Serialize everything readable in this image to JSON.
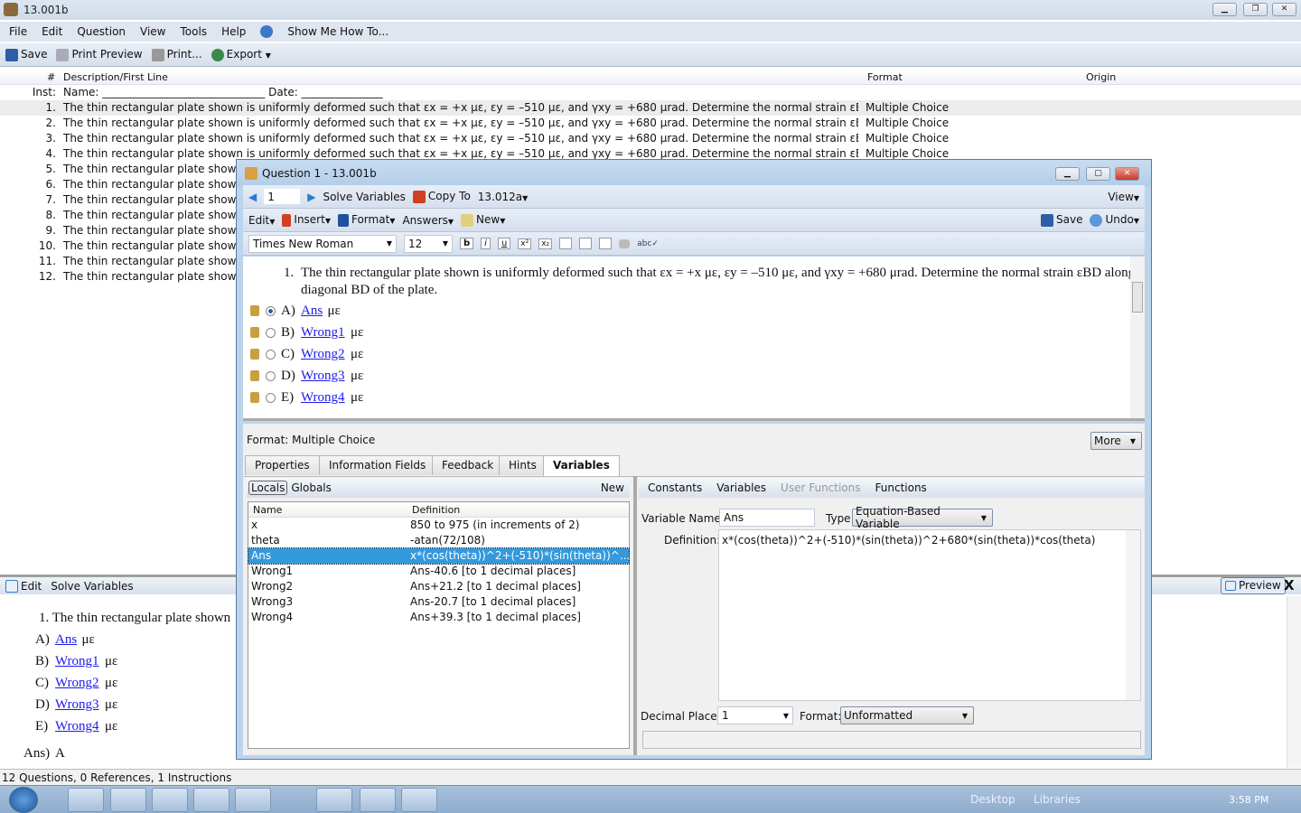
{
  "window": {
    "title": "13.001b"
  },
  "menu": [
    "File",
    "Edit",
    "Question",
    "View",
    "Tools",
    "Help",
    "Show Me How To..."
  ],
  "toolbar": {
    "save": "Save",
    "print_preview": "Print Preview",
    "print": "Print...",
    "export": "Export"
  },
  "list": {
    "headers": {
      "num": "#",
      "desc": "Description/First Line",
      "format": "Format",
      "origin": "Origin"
    },
    "inst": {
      "label": "Inst:",
      "text": "Name: ______________________________   Date: _______________"
    },
    "rows": [
      {
        "num": "1.",
        "desc": "The thin rectangular plate shown is uniformly deformed such that εx = +x με, εy = –510 με, and γxy = +680 μrad.  Determine the normal strain εBD along dia...",
        "format": "Multiple Choice"
      },
      {
        "num": "2.",
        "desc": "The thin rectangular plate shown is uniformly deformed such that εx = +x με, εy = –510 με, and γxy = +680 μrad.  Determine the normal strain εBD along dia...",
        "format": "Multiple Choice"
      },
      {
        "num": "3.",
        "desc": "The thin rectangular plate shown is uniformly deformed such that εx = +x με, εy = –510 με, and γxy = +680 μrad.  Determine the normal strain εBD along dia...",
        "format": "Multiple Choice"
      },
      {
        "num": "4.",
        "desc": "The thin rectangular plate shown is uniformly deformed such that εx = +x με, εy = –510 με, and γxy = +680 μrad.  Determine the normal strain εBD along dia...",
        "format": "Multiple Choice"
      },
      {
        "num": "5.",
        "desc": "The thin rectangular plate shown i",
        "format": ""
      },
      {
        "num": "6.",
        "desc": "The thin rectangular plate shown i",
        "format": ""
      },
      {
        "num": "7.",
        "desc": "The thin rectangular plate shown i",
        "format": ""
      },
      {
        "num": "8.",
        "desc": "The thin rectangular plate shown i",
        "format": ""
      },
      {
        "num": "9.",
        "desc": "The thin rectangular plate shown i",
        "format": ""
      },
      {
        "num": "10.",
        "desc": "The thin rectangular plate shown i",
        "format": ""
      },
      {
        "num": "11.",
        "desc": "The thin rectangular plate shown i",
        "format": ""
      },
      {
        "num": "12.",
        "desc": "The thin rectangular plate shown i",
        "format": ""
      }
    ]
  },
  "bottom_pane": {
    "edit": "Edit",
    "solve": "Solve Variables",
    "preview": "Preview",
    "close": "X",
    "question": "1.  The thin rectangular plate shown",
    "choices": [
      {
        "l": "A)",
        "v": "Ans",
        "u": "με"
      },
      {
        "l": "B)",
        "v": "Wrong1",
        "u": "με"
      },
      {
        "l": "C)",
        "v": "Wrong2",
        "u": "με"
      },
      {
        "l": "D)",
        "v": "Wrong3",
        "u": "με"
      },
      {
        "l": "E)",
        "v": "Wrong4",
        "u": "με"
      }
    ],
    "ans_label": "Ans)",
    "ans": "A"
  },
  "status": "12 Questions, 0 References, 1 Instructions",
  "taskbar": {
    "desktop": "Desktop",
    "libraries": "Libraries",
    "time": "3:58 PM"
  },
  "dialog": {
    "title": "Question 1 - 13.001b",
    "nav_value": "1",
    "solve": "Solve Variables",
    "copy_to": "Copy To",
    "copy_target": "13.012a",
    "view": "View",
    "edit": "Edit",
    "insert": "Insert",
    "format": "Format",
    "answers": "Answers",
    "new": "New",
    "save": "Save",
    "undo": "Undo",
    "font": "Times New Roman",
    "size": "12",
    "question_num": "1.",
    "question_line1": "The thin rectangular plate shown is uniformly deformed such that εx = +x με, εy = –510 με, and γxy = +680 μrad.  Determine the normal strain εBD along",
    "question_line2": "diagonal BD of the plate.",
    "choices": [
      {
        "l": "A)",
        "v": "Ans",
        "u": "με",
        "selected": true
      },
      {
        "l": "B)",
        "v": "Wrong1",
        "u": "με"
      },
      {
        "l": "C)",
        "v": "Wrong2",
        "u": "με"
      },
      {
        "l": "D)",
        "v": "Wrong3",
        "u": "με"
      },
      {
        "l": "E)",
        "v": "Wrong4",
        "u": "με"
      }
    ],
    "format_label": "Format: Multiple Choice",
    "more": "More",
    "tabs": [
      "Properties",
      "Information Fields",
      "Feedback",
      "Hints",
      "Variables"
    ],
    "active_tab": "Variables",
    "locals": "Locals",
    "globals": "Globals",
    "new_var": "New",
    "var_headers": {
      "name": "Name",
      "def": "Definition"
    },
    "vars": [
      {
        "name": "x",
        "def": "850 to 975 (in increments of 2)"
      },
      {
        "name": "theta",
        "def": "-atan(72/108)"
      },
      {
        "name": "Ans",
        "def": "x*(cos(theta))^2+(-510)*(sin(theta))^...",
        "selected": true
      },
      {
        "name": "Wrong1",
        "def": "Ans-40.6 [to 1 decimal places]"
      },
      {
        "name": "Wrong2",
        "def": "Ans+21.2 [to 1 decimal places]"
      },
      {
        "name": "Wrong3",
        "def": "Ans-20.7 [to 1 decimal places]"
      },
      {
        "name": "Wrong4",
        "def": "Ans+39.3 [to 1 decimal places]"
      }
    ],
    "right_tabs": [
      "Constants",
      "Variables",
      "User Functions",
      "Functions"
    ],
    "var_name_label": "Variable Name:",
    "var_name": "Ans",
    "type_label": "Type:",
    "type": "Equation-Based Variable",
    "definition_label": "Definition:",
    "definition": "x*(cos(theta))^2+(-510)*(sin(theta))^2+680*(sin(theta))*cos(theta)",
    "decimal_label": "Decimal Places:",
    "decimal": "1",
    "fmt_label": "Format:",
    "fmt": "Unformatted"
  },
  "colors": {
    "link": "#1a1aee",
    "selection": "#3399dd",
    "titlebar": "#c7dcf1"
  }
}
